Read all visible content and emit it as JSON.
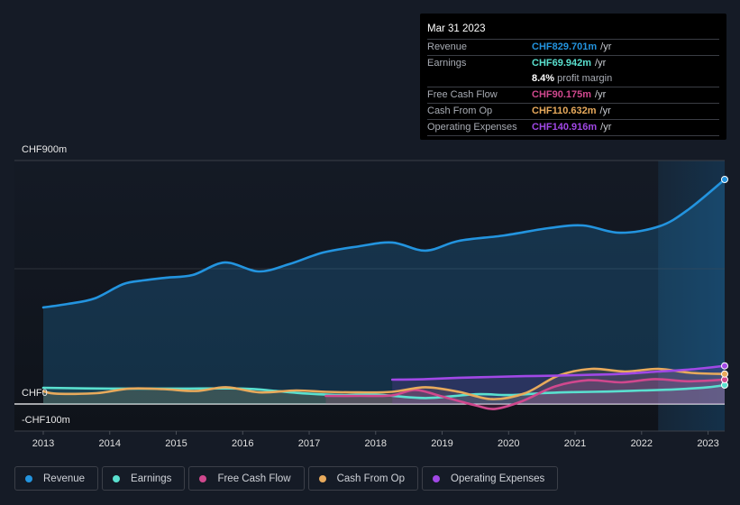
{
  "tooltip": {
    "date": "Mar 31 2023",
    "rows": [
      {
        "label": "Revenue",
        "value": "CHF829.701m",
        "unit": "/yr",
        "color": "#2394df"
      },
      {
        "label": "Earnings",
        "value": "CHF69.942m",
        "unit": "/yr",
        "color": "#5ae0cf"
      },
      {
        "label": "",
        "margin_value": "8.4%",
        "margin_text": "profit margin"
      },
      {
        "label": "Free Cash Flow",
        "value": "CHF90.175m",
        "unit": "/yr",
        "color": "#d0488e"
      },
      {
        "label": "Cash From Op",
        "value": "CHF110.632m",
        "unit": "/yr",
        "color": "#e8aa5c"
      },
      {
        "label": "Operating Expenses",
        "value": "CHF140.916m",
        "unit": "/yr",
        "color": "#a148e6"
      }
    ]
  },
  "legend": [
    {
      "label": "Revenue",
      "color": "#2394df"
    },
    {
      "label": "Earnings",
      "color": "#5ae0cf"
    },
    {
      "label": "Free Cash Flow",
      "color": "#d0488e"
    },
    {
      "label": "Cash From Op",
      "color": "#e8aa5c"
    },
    {
      "label": "Operating Expenses",
      "color": "#a148e6"
    }
  ],
  "chart_data": {
    "type": "area",
    "title": "",
    "xlabel": "",
    "ylabel": "",
    "y_tick_labels": {
      "top": "CHF900m",
      "zero": "CHF0",
      "bottom": "-CHF100m"
    },
    "ylim": [
      -100,
      900
    ],
    "xlim": [
      2013.0,
      2023.25
    ],
    "x_ticks": [
      "2013",
      "2014",
      "2015",
      "2016",
      "2017",
      "2018",
      "2019",
      "2020",
      "2021",
      "2022",
      "2023"
    ],
    "gridlines": [
      900,
      500,
      0
    ],
    "highlight_from": 2022.25,
    "series": [
      {
        "name": "Revenue",
        "color": "#2394df",
        "x": [
          2013.0,
          2013.37,
          2013.77,
          2014.2,
          2014.51,
          2014.85,
          2015.25,
          2015.73,
          2016.24,
          2016.7,
          2017.21,
          2017.75,
          2018.25,
          2018.75,
          2019.25,
          2019.93,
          2020.6,
          2021.12,
          2021.67,
          2022.27,
          2022.71,
          2023.25
        ],
        "y": [
          357,
          370,
          390,
          443,
          457,
          467,
          477,
          523,
          490,
          517,
          560,
          583,
          597,
          567,
          603,
          623,
          650,
          660,
          633,
          657,
          720,
          830
        ]
      },
      {
        "name": "Earnings",
        "color": "#5ae0cf",
        "x": [
          2013.0,
          2014.0,
          2015.0,
          2016.0,
          2016.5,
          2017.0,
          2017.5,
          2018.0,
          2018.75,
          2019.5,
          2020.0,
          2020.5,
          2021.0,
          2021.5,
          2022.0,
          2022.5,
          2023.0,
          2023.25
        ],
        "y": [
          60,
          57,
          57,
          57,
          48,
          38,
          33,
          35,
          22,
          36,
          33,
          40,
          44,
          46,
          50,
          54,
          62,
          70
        ]
      },
      {
        "name": "Free Cash Flow",
        "color": "#d0488e",
        "x": [
          2017.25,
          2017.75,
          2018.25,
          2018.6,
          2019.0,
          2019.5,
          2019.8,
          2020.2,
          2020.7,
          2021.2,
          2021.7,
          2022.2,
          2022.7,
          2023.25
        ],
        "y": [
          30,
          30,
          32,
          52,
          28,
          -5,
          -18,
          10,
          65,
          88,
          80,
          92,
          84,
          90
        ]
      },
      {
        "name": "Cash From Op",
        "color": "#e8aa5c",
        "x": [
          2013.0,
          2013.2,
          2013.8,
          2014.3,
          2014.8,
          2015.3,
          2015.75,
          2016.25,
          2016.8,
          2017.25,
          2017.75,
          2018.25,
          2018.75,
          2019.25,
          2019.75,
          2020.25,
          2020.75,
          2021.25,
          2021.75,
          2022.25,
          2022.75,
          2023.25
        ],
        "y": [
          47,
          38,
          40,
          57,
          55,
          48,
          62,
          43,
          50,
          45,
          43,
          45,
          62,
          45,
          18,
          40,
          105,
          130,
          120,
          130,
          115,
          111
        ]
      },
      {
        "name": "Operating Expenses",
        "color": "#a148e6",
        "x": [
          2018.25,
          2018.75,
          2019.25,
          2019.75,
          2020.25,
          2020.75,
          2021.25,
          2021.75,
          2022.25,
          2022.75,
          2023.25
        ],
        "y": [
          90,
          92,
          97,
          100,
          103,
          105,
          108,
          112,
          120,
          128,
          141
        ]
      }
    ]
  }
}
